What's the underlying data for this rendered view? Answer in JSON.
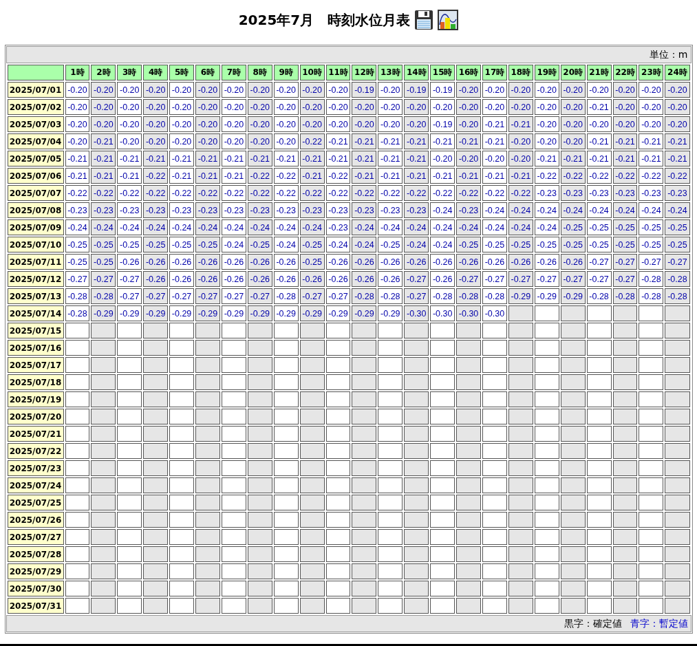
{
  "title": "2025年7月　時刻水位月表",
  "unit": "単位：m",
  "columns": [
    "1時",
    "2時",
    "3時",
    "4時",
    "5時",
    "6時",
    "7時",
    "8時",
    "9時",
    "10時",
    "11時",
    "12時",
    "13時",
    "14時",
    "15時",
    "16時",
    "17時",
    "18時",
    "19時",
    "20時",
    "21時",
    "22時",
    "23時",
    "24時"
  ],
  "rows": [
    {
      "date": "2025/07/01",
      "provisional": true,
      "values": [
        "-0.20",
        "-0.20",
        "-0.20",
        "-0.20",
        "-0.20",
        "-0.20",
        "-0.20",
        "-0.20",
        "-0.20",
        "-0.20",
        "-0.20",
        "-0.19",
        "-0.20",
        "-0.19",
        "-0.19",
        "-0.20",
        "-0.20",
        "-0.20",
        "-0.20",
        "-0.20",
        "-0.20",
        "-0.20",
        "-0.20",
        "-0.20"
      ]
    },
    {
      "date": "2025/07/02",
      "provisional": true,
      "values": [
        "-0.20",
        "-0.20",
        "-0.20",
        "-0.20",
        "-0.20",
        "-0.20",
        "-0.20",
        "-0.20",
        "-0.20",
        "-0.20",
        "-0.20",
        "-0.20",
        "-0.20",
        "-0.20",
        "-0.20",
        "-0.20",
        "-0.20",
        "-0.20",
        "-0.20",
        "-0.20",
        "-0.21",
        "-0.20",
        "-0.20",
        "-0.20"
      ]
    },
    {
      "date": "2025/07/03",
      "provisional": true,
      "values": [
        "-0.20",
        "-0.20",
        "-0.20",
        "-0.20",
        "-0.20",
        "-0.20",
        "-0.20",
        "-0.20",
        "-0.20",
        "-0.20",
        "-0.20",
        "-0.20",
        "-0.20",
        "-0.20",
        "-0.19",
        "-0.20",
        "-0.21",
        "-0.21",
        "-0.20",
        "-0.20",
        "-0.20",
        "-0.20",
        "-0.20",
        "-0.20"
      ]
    },
    {
      "date": "2025/07/04",
      "provisional": true,
      "values": [
        "-0.20",
        "-0.21",
        "-0.20",
        "-0.20",
        "-0.20",
        "-0.20",
        "-0.20",
        "-0.20",
        "-0.20",
        "-0.22",
        "-0.21",
        "-0.21",
        "-0.21",
        "-0.21",
        "-0.21",
        "-0.21",
        "-0.21",
        "-0.20",
        "-0.20",
        "-0.20",
        "-0.21",
        "-0.21",
        "-0.21",
        "-0.21"
      ]
    },
    {
      "date": "2025/07/05",
      "provisional": true,
      "values": [
        "-0.21",
        "-0.21",
        "-0.21",
        "-0.21",
        "-0.21",
        "-0.21",
        "-0.21",
        "-0.21",
        "-0.21",
        "-0.21",
        "-0.21",
        "-0.21",
        "-0.21",
        "-0.21",
        "-0.20",
        "-0.20",
        "-0.20",
        "-0.20",
        "-0.21",
        "-0.21",
        "-0.21",
        "-0.21",
        "-0.21",
        "-0.21"
      ]
    },
    {
      "date": "2025/07/06",
      "provisional": true,
      "values": [
        "-0.21",
        "-0.21",
        "-0.21",
        "-0.22",
        "-0.21",
        "-0.21",
        "-0.21",
        "-0.22",
        "-0.22",
        "-0.21",
        "-0.22",
        "-0.21",
        "-0.21",
        "-0.21",
        "-0.21",
        "-0.21",
        "-0.21",
        "-0.21",
        "-0.22",
        "-0.22",
        "-0.22",
        "-0.22",
        "-0.22",
        "-0.22"
      ]
    },
    {
      "date": "2025/07/07",
      "provisional": true,
      "values": [
        "-0.22",
        "-0.22",
        "-0.22",
        "-0.22",
        "-0.22",
        "-0.22",
        "-0.22",
        "-0.22",
        "-0.22",
        "-0.22",
        "-0.22",
        "-0.22",
        "-0.22",
        "-0.22",
        "-0.22",
        "-0.22",
        "-0.22",
        "-0.22",
        "-0.23",
        "-0.23",
        "-0.23",
        "-0.23",
        "-0.23",
        "-0.23"
      ]
    },
    {
      "date": "2025/07/08",
      "provisional": true,
      "values": [
        "-0.23",
        "-0.23",
        "-0.23",
        "-0.23",
        "-0.23",
        "-0.23",
        "-0.23",
        "-0.23",
        "-0.23",
        "-0.23",
        "-0.23",
        "-0.23",
        "-0.23",
        "-0.23",
        "-0.24",
        "-0.23",
        "-0.24",
        "-0.24",
        "-0.24",
        "-0.24",
        "-0.24",
        "-0.24",
        "-0.24",
        "-0.24"
      ]
    },
    {
      "date": "2025/07/09",
      "provisional": true,
      "values": [
        "-0.24",
        "-0.24",
        "-0.24",
        "-0.24",
        "-0.24",
        "-0.24",
        "-0.24",
        "-0.24",
        "-0.24",
        "-0.24",
        "-0.23",
        "-0.24",
        "-0.24",
        "-0.24",
        "-0.24",
        "-0.24",
        "-0.24",
        "-0.24",
        "-0.24",
        "-0.25",
        "-0.25",
        "-0.25",
        "-0.25",
        "-0.25"
      ]
    },
    {
      "date": "2025/07/10",
      "provisional": true,
      "values": [
        "-0.25",
        "-0.25",
        "-0.25",
        "-0.25",
        "-0.25",
        "-0.25",
        "-0.24",
        "-0.25",
        "-0.24",
        "-0.25",
        "-0.24",
        "-0.24",
        "-0.25",
        "-0.24",
        "-0.24",
        "-0.25",
        "-0.25",
        "-0.25",
        "-0.25",
        "-0.25",
        "-0.25",
        "-0.25",
        "-0.25",
        "-0.25"
      ]
    },
    {
      "date": "2025/07/11",
      "provisional": true,
      "values": [
        "-0.25",
        "-0.25",
        "-0.26",
        "-0.26",
        "-0.26",
        "-0.26",
        "-0.26",
        "-0.26",
        "-0.26",
        "-0.25",
        "-0.26",
        "-0.26",
        "-0.26",
        "-0.26",
        "-0.26",
        "-0.26",
        "-0.26",
        "-0.26",
        "-0.26",
        "-0.26",
        "-0.27",
        "-0.27",
        "-0.27",
        "-0.27"
      ]
    },
    {
      "date": "2025/07/12",
      "provisional": true,
      "values": [
        "-0.27",
        "-0.27",
        "-0.27",
        "-0.26",
        "-0.26",
        "-0.26",
        "-0.26",
        "-0.26",
        "-0.26",
        "-0.26",
        "-0.26",
        "-0.26",
        "-0.26",
        "-0.27",
        "-0.26",
        "-0.27",
        "-0.27",
        "-0.27",
        "-0.27",
        "-0.27",
        "-0.27",
        "-0.27",
        "-0.28",
        "-0.28"
      ]
    },
    {
      "date": "2025/07/13",
      "provisional": true,
      "values": [
        "-0.28",
        "-0.28",
        "-0.27",
        "-0.27",
        "-0.27",
        "-0.27",
        "-0.27",
        "-0.27",
        "-0.28",
        "-0.27",
        "-0.27",
        "-0.28",
        "-0.28",
        "-0.27",
        "-0.28",
        "-0.28",
        "-0.28",
        "-0.29",
        "-0.29",
        "-0.29",
        "-0.28",
        "-0.28",
        "-0.28",
        "-0.28"
      ]
    },
    {
      "date": "2025/07/14",
      "provisional": true,
      "values": [
        "-0.28",
        "-0.29",
        "-0.29",
        "-0.29",
        "-0.29",
        "-0.29",
        "-0.29",
        "-0.29",
        "-0.29",
        "-0.29",
        "-0.29",
        "-0.29",
        "-0.29",
        "-0.30",
        "-0.30",
        "-0.30",
        "-0.30"
      ]
    },
    {
      "date": "2025/07/15"
    },
    {
      "date": "2025/07/16"
    },
    {
      "date": "2025/07/17"
    },
    {
      "date": "2025/07/18"
    },
    {
      "date": "2025/07/19"
    },
    {
      "date": "2025/07/20"
    },
    {
      "date": "2025/07/21"
    },
    {
      "date": "2025/07/22"
    },
    {
      "date": "2025/07/23"
    },
    {
      "date": "2025/07/24"
    },
    {
      "date": "2025/07/25"
    },
    {
      "date": "2025/07/26"
    },
    {
      "date": "2025/07/27"
    },
    {
      "date": "2025/07/28"
    },
    {
      "date": "2025/07/29"
    },
    {
      "date": "2025/07/30"
    },
    {
      "date": "2025/07/31"
    }
  ],
  "legend": [
    {
      "label": "黒字：確定値",
      "kind": "confirmed"
    },
    {
      "label": "青字：暫定値",
      "kind": "provisional"
    }
  ]
}
